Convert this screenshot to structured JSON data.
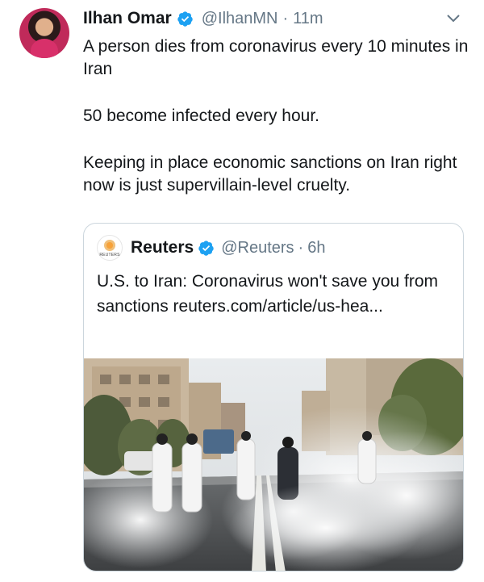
{
  "tweet": {
    "author_name": "Ilhan Omar",
    "handle": "@IlhanMN",
    "separator": "·",
    "time": "11m",
    "lines": [
      "A person dies from coronavirus every 10 minutes in Iran",
      "50 become infected every hour.",
      "Keeping in place economic sanctions on Iran right now is just supervillain-level cruelty."
    ]
  },
  "quoted": {
    "author_name": "Reuters",
    "handle": "@Reuters",
    "separator": "·",
    "time": "6h",
    "avatar_wordmark": "REUTERS",
    "text": "U.S. to Iran: Coronavirus won't save you from sanctions reuters.com/article/us-hea..."
  },
  "icons": {
    "verified": "verified-badge-icon",
    "menu": "chevron-down-icon"
  },
  "colors": {
    "verified_blue": "#1da1f2",
    "secondary_text": "#657786",
    "border": "#ccd6dd"
  }
}
